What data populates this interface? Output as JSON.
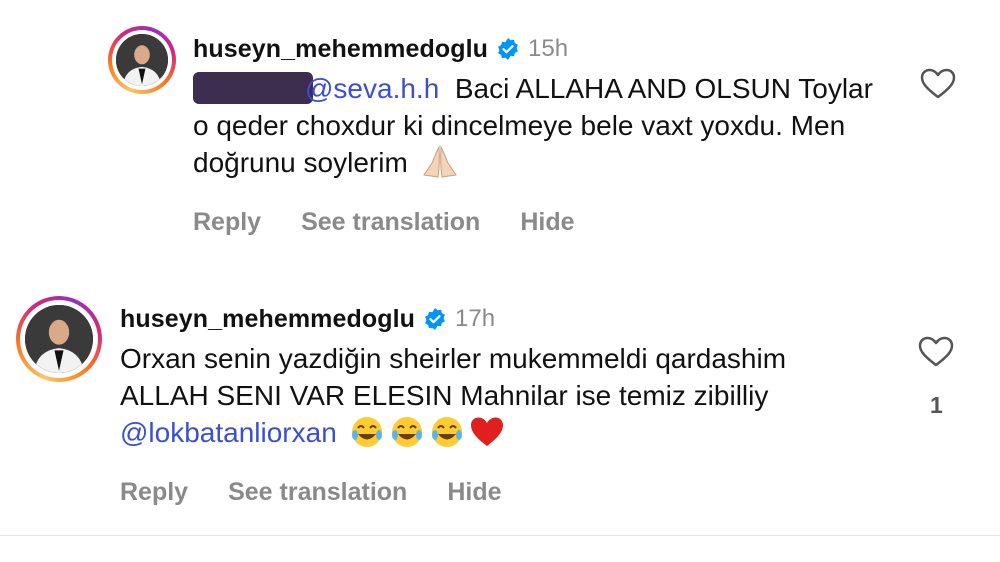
{
  "comments": [
    {
      "username": "huseyn_mehemmedoglu",
      "time": "15h",
      "mention": "@seva.h.h",
      "text": "Baci ALLAHA AND OLSUN Toylar o qeder choxdur ki dincelmeye bele vaxt yoxdu. Men doğrunu soylerim",
      "actions": {
        "reply": "Reply",
        "translate": "See translation",
        "hide": "Hide"
      }
    },
    {
      "username": "huseyn_mehemmedoglu",
      "time": "17h",
      "text": "Orxan senin yazdiğin sheirler mukemmeldi qardashim ALLAH SENI VAR ELESIN Mahnilar ise temiz  zibilliy",
      "mention": "@lokbatanliorxan",
      "like_count": "1",
      "actions": {
        "reply": "Reply",
        "translate": "See translation",
        "hide": "Hide"
      }
    }
  ],
  "colors": {
    "mention": "#3a4fd6",
    "verified": "#0095f6",
    "muted": "#8a8a8a"
  },
  "icons": [
    "verified-badge-icon",
    "heart-outline-icon",
    "folded-hands-emoji",
    "tears-of-joy-emoji",
    "red-heart-emoji"
  ]
}
